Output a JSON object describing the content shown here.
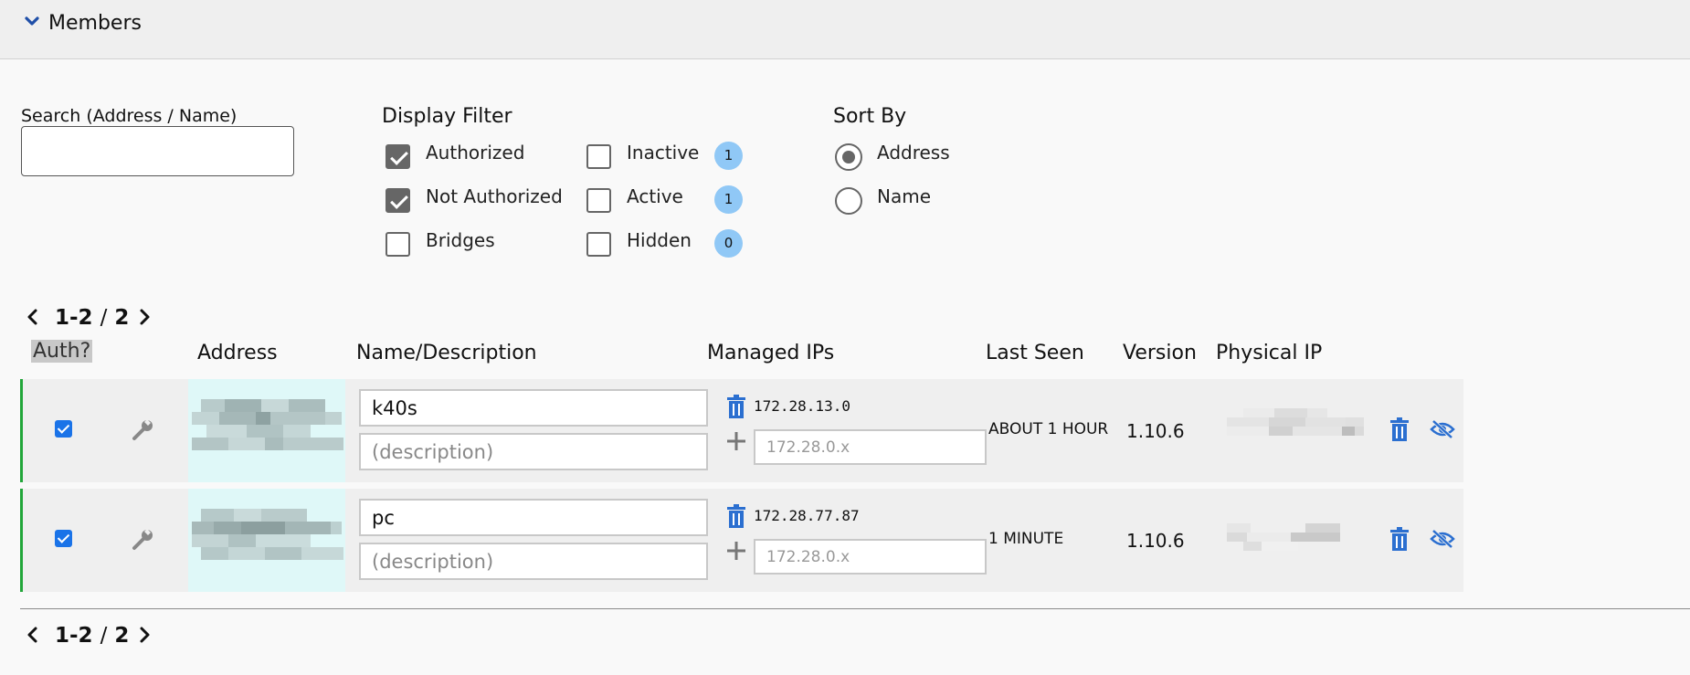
{
  "section": {
    "title": "Members"
  },
  "search": {
    "label": "Search (Address / Name)",
    "value": ""
  },
  "display_filter": {
    "title": "Display Filter",
    "authorized": {
      "label": "Authorized",
      "checked": true
    },
    "not_authorized": {
      "label": "Not Authorized",
      "checked": true
    },
    "bridges": {
      "label": "Bridges",
      "checked": false
    },
    "inactive": {
      "label": "Inactive",
      "checked": false,
      "count": "1"
    },
    "active": {
      "label": "Active",
      "checked": false,
      "count": "1"
    },
    "hidden": {
      "label": "Hidden",
      "checked": false,
      "count": "0"
    }
  },
  "sort_by": {
    "title": "Sort By",
    "options": [
      {
        "label": "Address",
        "selected": true
      },
      {
        "label": "Name",
        "selected": false
      }
    ]
  },
  "pager": {
    "range": "1-2",
    "separator": "/",
    "total": "2"
  },
  "columns": {
    "auth": "Auth?",
    "address": "Address",
    "name": "Name/Description",
    "managed_ips": "Managed IPs",
    "last_seen": "Last Seen",
    "version": "Version",
    "physical_ip": "Physical IP"
  },
  "members": [
    {
      "authorized": true,
      "name": "k40s",
      "description_placeholder": "(description)",
      "managed_ip": "172.28.13.0",
      "ip_placeholder": "172.28.0.x",
      "last_seen": "ABOUT 1 HOUR",
      "version": "1.10.6"
    },
    {
      "authorized": true,
      "name": "pc",
      "description_placeholder": "(description)",
      "managed_ip": "172.28.77.87",
      "ip_placeholder": "172.28.0.x",
      "last_seen": "1 MINUTE",
      "version": "1.10.6"
    }
  ],
  "colors": {
    "accent_blue": "#1a73e8",
    "icon_blue": "#2b6fd0",
    "authorized_green": "#22a63a",
    "badge_blue": "#90c8f6"
  },
  "icons": {
    "collapse": "chevron-down-icon",
    "row_settings": "wrench-icon",
    "remove_ip": "trash-icon",
    "add_ip": "plus-icon",
    "delete_member": "trash-icon",
    "hide_member": "eye-off-icon"
  }
}
